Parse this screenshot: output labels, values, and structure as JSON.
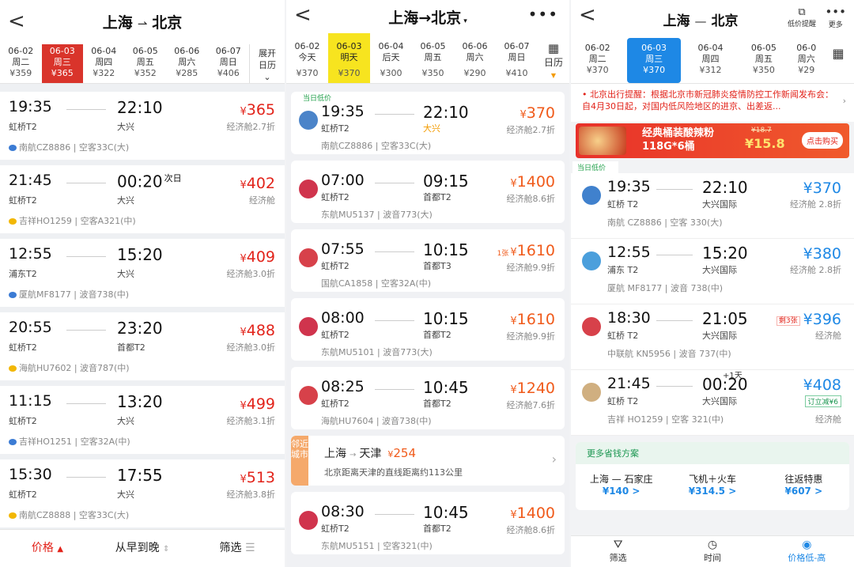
{
  "p1": {
    "title_from": "上海",
    "title_to": "北京",
    "dates": [
      {
        "d": "06-02",
        "w": "周二",
        "p": "¥359"
      },
      {
        "d": "06-03",
        "w": "周三",
        "p": "¥365"
      },
      {
        "d": "06-04",
        "w": "周四",
        "p": "¥322"
      },
      {
        "d": "06-05",
        "w": "周五",
        "p": "¥352"
      },
      {
        "d": "06-06",
        "w": "周六",
        "p": "¥285"
      },
      {
        "d": "06-07",
        "w": "周日",
        "p": "¥406"
      }
    ],
    "expand_l1": "展开",
    "expand_l2": "日历",
    "flights": [
      {
        "dep": "19:35",
        "arr": "22:10",
        "nd": "",
        "da": "虹桥T2",
        "aa": "大兴",
        "price": "365",
        "cls": "经济舱2.7折",
        "air": "南航CZ8886 | 空客33C(大)"
      },
      {
        "dep": "21:45",
        "arr": "00:20",
        "nd": "次日",
        "da": "虹桥T2",
        "aa": "大兴",
        "price": "402",
        "cls": "经济舱",
        "air": "吉祥HO1259 | 空客A321(中)"
      },
      {
        "dep": "12:55",
        "arr": "15:20",
        "nd": "",
        "da": "浦东T2",
        "aa": "大兴",
        "price": "409",
        "cls": "经济舱3.0折",
        "air": "厦航MF8177 | 波音738(中)"
      },
      {
        "dep": "20:55",
        "arr": "23:20",
        "nd": "",
        "da": "虹桥T2",
        "aa": "首都T2",
        "price": "488",
        "cls": "经济舱3.0折",
        "air": "海航HU7602 | 波音787(中)"
      },
      {
        "dep": "11:15",
        "arr": "13:20",
        "nd": "",
        "da": "虹桥T2",
        "aa": "大兴",
        "price": "499",
        "cls": "经济舱3.1折",
        "air": "吉祥HO1251 | 空客32A(中)"
      },
      {
        "dep": "15:30",
        "arr": "17:55",
        "nd": "",
        "da": "虹桥T2",
        "aa": "大兴",
        "price": "513",
        "cls": "经济舱3.8折",
        "air": "南航CZ8888 | 空客33C(大)"
      }
    ],
    "sort": {
      "price": "价格",
      "time": "从早到晚",
      "filter": "筛选"
    }
  },
  "p2": {
    "title": "上海→北京",
    "dates": [
      {
        "d": "06-02",
        "w": "今天",
        "p": "¥370"
      },
      {
        "d": "06-03",
        "w": "明天",
        "p": "¥370"
      },
      {
        "d": "06-04",
        "w": "后天",
        "p": "¥300"
      },
      {
        "d": "06-05",
        "w": "周五",
        "p": "¥350"
      },
      {
        "d": "06-06",
        "w": "周六",
        "p": "¥290"
      },
      {
        "d": "06-07",
        "w": "周日",
        "p": "¥410"
      }
    ],
    "cal": "日历",
    "badge": "当日低价",
    "flights": [
      {
        "dep": "19:35",
        "arr": "22:10",
        "da": "虹桥T2",
        "aa": "大兴",
        "price": "370",
        "cls": "经济舱2.7折",
        "air": "南航CZ8886 | 空客33C(大)",
        "tag": "",
        "logo": "#2b6fc0"
      },
      {
        "dep": "07:00",
        "arr": "09:15",
        "da": "虹桥T2",
        "aa": "首都T2",
        "price": "1400",
        "cls": "经济舱8.6折",
        "air": "东航MU5137 | 波音773(大)",
        "tag": "",
        "logo": "#c8102e"
      },
      {
        "dep": "07:55",
        "arr": "10:15",
        "da": "虹桥T2",
        "aa": "首都T3",
        "price": "1610",
        "cls": "经济舱9.9折",
        "air": "国航CA1858 | 空客32A(中)",
        "tag": "1张",
        "logo": "#d0202a"
      },
      {
        "dep": "08:00",
        "arr": "10:15",
        "da": "虹桥T2",
        "aa": "首都T2",
        "price": "1610",
        "cls": "经济舱9.9折",
        "air": "东航MU5101 | 波音773(大)",
        "tag": "",
        "logo": "#c8102e"
      },
      {
        "dep": "08:25",
        "arr": "10:45",
        "da": "虹桥T2",
        "aa": "首都T2",
        "price": "1240",
        "cls": "经济舱7.6折",
        "air": "海航HU7604 | 波音738(中)",
        "tag": "",
        "logo": "#d0202a"
      }
    ],
    "near": {
      "label": "邻近城市",
      "from": "上海",
      "to": "天津",
      "price": "254",
      "desc": "北京距离天津的直线距离约113公里"
    },
    "last": {
      "dep": "08:30",
      "arr": "10:45",
      "da": "虹桥T2",
      "aa": "首都T2",
      "price": "1400",
      "cls": "经济舱8.6折",
      "air": "东航MU5151 | 空客321(中)"
    }
  },
  "p3": {
    "title_from": "上海",
    "title_to": "北京",
    "low_remind": "低价提醒",
    "more": "更多",
    "dates": [
      {
        "d": "06-02",
        "w": "周二",
        "p": "¥370"
      },
      {
        "d": "06-03",
        "w": "周三",
        "p": "¥370"
      },
      {
        "d": "06-04",
        "w": "周四",
        "p": "¥312"
      },
      {
        "d": "06-05",
        "w": "周五",
        "p": "¥350"
      },
      {
        "d": "06-0",
        "w": "周六",
        "p": "¥29"
      }
    ],
    "notice": "• 北京出行提醒：根据北京市新冠肺炎疫情防控工作新闻发布会：自4月30日起，对国内低风险地区的进京、出差返...",
    "ad": {
      "line1": "经典桶装酸辣粉",
      "line2": "118G*6桶",
      "old": "¥18.7",
      "price": "¥15.8",
      "btn": "点击购买"
    },
    "badge": "当日低价",
    "flights": [
      {
        "dep": "19:35",
        "arr": "22:10",
        "da": "虹桥 T2",
        "aa": "大兴国际",
        "price": "370",
        "cls": "经济舱 2.8折",
        "air": "南航 CZ8886 | 空客 330(大)",
        "tag": "",
        "nd": ""
      },
      {
        "dep": "12:55",
        "arr": "15:20",
        "da": "浦东 T2",
        "aa": "大兴国际",
        "price": "380",
        "cls": "经济舱 2.8折",
        "air": "厦航 MF8177 | 波音 738(中)",
        "tag": "",
        "nd": ""
      },
      {
        "dep": "18:30",
        "arr": "21:05",
        "da": "虹桥 T2",
        "aa": "大兴国际",
        "price": "396",
        "cls": "经济舱",
        "air": "中联航 KN5956 | 波音 737(中)",
        "tag": "剩3张",
        "nd": ""
      },
      {
        "dep": "21:45",
        "arr": "00:20",
        "da": "虹桥 T2",
        "aa": "大兴国际",
        "price": "408",
        "cls": "经济舱",
        "air": "吉祥 HO1259 | 空客 321(中)",
        "tag": "订立减¥6",
        "nd": "+1天"
      }
    ],
    "save": {
      "title": "更多省钱方案",
      "a_route": "上海 — 石家庄",
      "a_price": "¥140 >",
      "b_route": "飞机＋火车",
      "b_price": "¥314.5 >",
      "c_route": "往返特惠",
      "c_price": "¥607 >"
    },
    "tabs": {
      "filter": "筛选",
      "time": "时间",
      "price": "价格低-高"
    }
  }
}
